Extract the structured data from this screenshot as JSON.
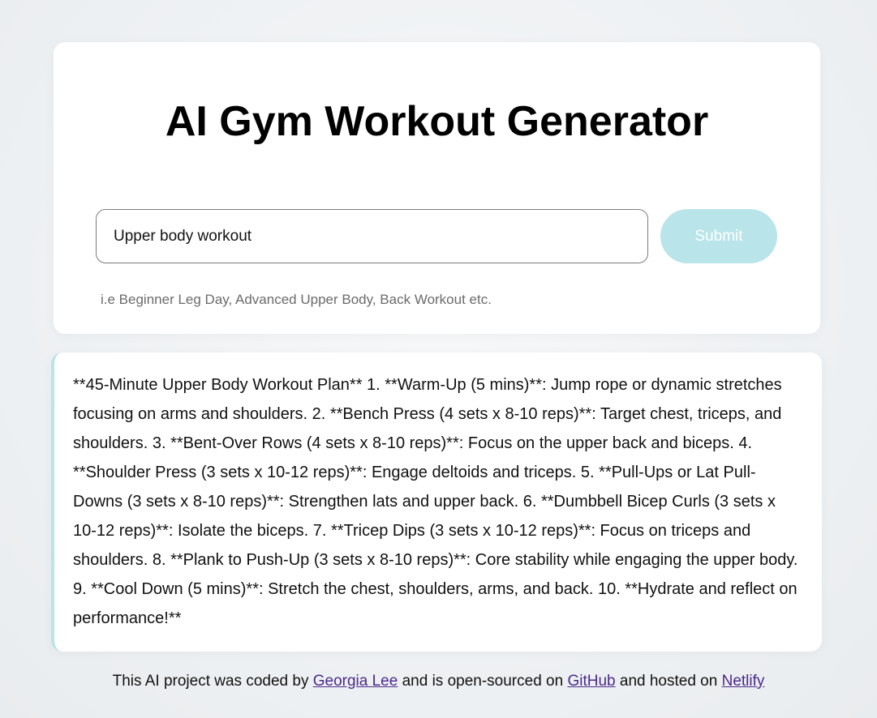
{
  "header": {
    "title": "AI Gym Workout Generator"
  },
  "form": {
    "input_value": "Upper body workout",
    "submit_label": "Submit",
    "hint": "i.e Beginner Leg Day, Advanced Upper Body, Back Workout etc."
  },
  "result": {
    "text": "**45-Minute Upper Body Workout Plan** 1. **Warm-Up (5 mins)**: Jump rope or dynamic stretches focusing on arms and shoulders. 2. **Bench Press (4 sets x 8-10 reps)**: Target chest, triceps, and shoulders. 3. **Bent-Over Rows (4 sets x 8-10 reps)**: Focus on the upper back and biceps. 4. **Shoulder Press (3 sets x 10-12 reps)**: Engage deltoids and triceps. 5. **Pull-Ups or Lat Pull-Downs (3 sets x 8-10 reps)**: Strengthen lats and upper back. 6. **Dumbbell Bicep Curls (3 sets x 10-12 reps)**: Isolate the biceps. 7. **Tricep Dips (3 sets x 10-12 reps)**: Focus on triceps and shoulders. 8. **Plank to Push-Up (3 sets x 8-10 reps)**: Core stability while engaging the upper body. 9. **Cool Down (5 mins)**: Stretch the chest, shoulders, arms, and back. 10. **Hydrate and reflect on performance!**"
  },
  "footer": {
    "text_1": "This AI project was coded by ",
    "author_link": "Georgia Lee",
    "text_2": " and is open-sourced on ",
    "github_link": "GitHub",
    "text_3": " and hosted on ",
    "netlify_link": "Netlify"
  },
  "colors": {
    "accent": "#b9e4ea",
    "link": "#4b2a8a",
    "background": "#eef1f3"
  }
}
